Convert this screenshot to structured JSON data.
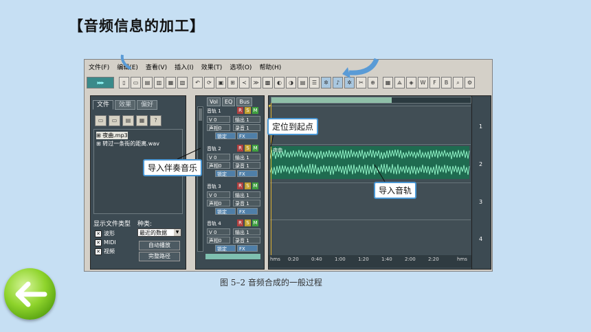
{
  "slide": {
    "title": "【音频信息的加工】",
    "caption": "图 5–2  音频合成的一般过程"
  },
  "app": {
    "menu": [
      "文件(F)",
      "编辑(E)",
      "查看(V)",
      "插入(I)",
      "效果(T)",
      "选项(O)",
      "帮助(H)"
    ],
    "left_panel": {
      "tabs": [
        "文件",
        "效果",
        "偏好"
      ],
      "files": [
        "夜曲.mp3",
        "转过一条街的距离.wav"
      ],
      "file_type_label": "显示文件类型",
      "kind_label": "种类:",
      "file_types": [
        "波形",
        "MIDI",
        "视频"
      ],
      "kind_value": "最近的数据",
      "auto_play_button": "自动播放",
      "full_path_button": "完整路径"
    },
    "mixer_tabs": [
      "Vol",
      "EQ",
      "Bus"
    ],
    "tracks": [
      {
        "name": "音轨 1",
        "vol": "V 0",
        "pan": "声相0",
        "out": "输出 1",
        "rec": "录音 1",
        "lock": "锁定",
        "fx": "FX"
      },
      {
        "name": "音轨 2",
        "vol": "V 0",
        "pan": "声相0",
        "out": "输出 1",
        "rec": "录音 1",
        "lock": "锁定",
        "fx": "FX"
      },
      {
        "name": "音轨 3",
        "vol": "V 0",
        "pan": "声相0",
        "out": "输出 1",
        "rec": "录音 1",
        "lock": "锁定",
        "fx": "FX"
      },
      {
        "name": "音轨 4",
        "vol": "V 0",
        "pan": "声相0",
        "out": "输出 1",
        "rec": "录音 1",
        "lock": "锁定",
        "fx": "FX"
      }
    ],
    "rsm": [
      "R",
      "S",
      "M"
    ],
    "clip_label": "夜曲",
    "ruler": [
      "hms",
      "0:20",
      "0:40",
      "1:00",
      "1:20",
      "1:40",
      "2:00",
      "2:20",
      "hms"
    ],
    "track_numbers": [
      "1",
      "2",
      "3",
      "4"
    ],
    "toolbar_icons": [
      "play-mode",
      "new",
      "open",
      "save",
      "print",
      "copy",
      "paste",
      "undo",
      "loop",
      "edit",
      "zoom",
      "wave",
      "mix",
      "effect",
      "envelope",
      "snap",
      "marker",
      "stretch",
      "pitch",
      "noise",
      "align",
      "trim",
      "cut",
      "split",
      "merge",
      "group",
      "lock",
      "wet",
      "fx",
      "bpm",
      "search",
      "tools"
    ]
  },
  "callouts": {
    "locate_start": "定位到起点",
    "import_music": "导入伴奏音乐",
    "import_track": "导入音轨"
  },
  "colors": {
    "slide_bg": "#c6dff3",
    "callout_border": "#4a97d4",
    "waveform": "#7fe0b8",
    "back_button": "#8fd42c"
  }
}
